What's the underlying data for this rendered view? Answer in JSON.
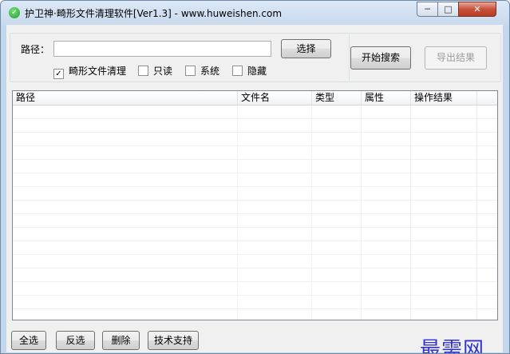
{
  "window": {
    "title": "护卫神·畸形文件清理软件[Ver1.3] - www.huweishen.com",
    "app_icon": "shield-icon",
    "controls": {
      "minimize": "─",
      "maximize": "□",
      "close": "✕"
    }
  },
  "search": {
    "path_label": "路径：",
    "path_value": "",
    "select_label": "选择",
    "start_label": "开始搜索",
    "export_label": "导出结果"
  },
  "filters": [
    {
      "label": "畸形文件清理",
      "checked": true
    },
    {
      "label": "只读",
      "checked": false
    },
    {
      "label": "系统",
      "checked": false
    },
    {
      "label": "隐藏",
      "checked": false
    }
  ],
  "table": {
    "columns": [
      "路径",
      "文件名",
      "类型",
      "属性",
      "操作结果"
    ],
    "rows": []
  },
  "actions": {
    "select_all": "全选",
    "invert": "反选",
    "delete": "删除",
    "support": "技术支持"
  },
  "watermark": "最需网"
}
